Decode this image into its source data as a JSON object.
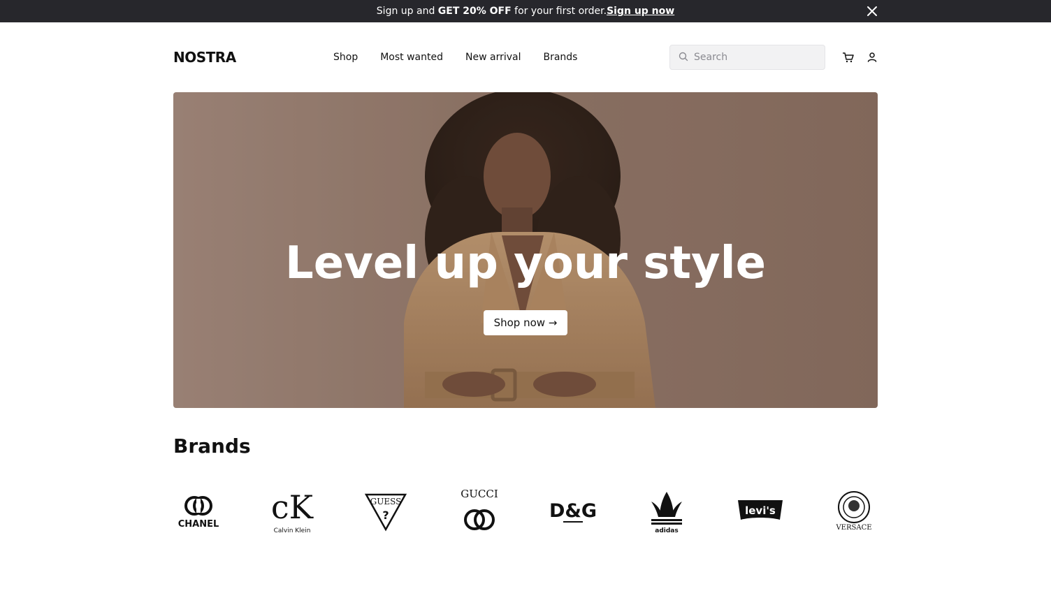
{
  "promo": {
    "text_before": "Sign up and ",
    "text_strong": "GET 20% OFF",
    "text_after": " for your first order. ",
    "link_label": "Sign up now"
  },
  "header": {
    "logo": "NOSTRA",
    "nav": [
      "Shop",
      "Most wanted",
      "New arrival",
      "Brands"
    ],
    "search_placeholder": "Search",
    "icons": [
      "search-icon",
      "cart-icon",
      "user-icon",
      "close-icon"
    ]
  },
  "hero": {
    "title": "Level up your style",
    "button_label": "Shop now →"
  },
  "brands": {
    "title": "Brands",
    "items": [
      "CHANEL",
      "Calvin Klein",
      "GUESS",
      "GUCCI",
      "D&G",
      "adidas",
      "levi's",
      "VERSACE"
    ]
  },
  "colors": {
    "promo_bg": "#27272c",
    "hero_bg": "#8f7568",
    "text": "#111111"
  }
}
